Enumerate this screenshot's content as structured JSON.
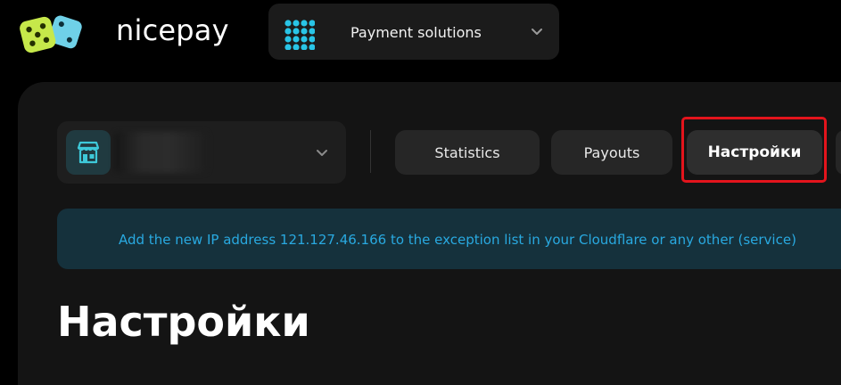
{
  "header": {
    "brand": "nicepay",
    "product_selector": {
      "label": "Payment solutions",
      "icon": "grid-icon"
    }
  },
  "shop_selector": {
    "icon": "store-icon",
    "name_redacted": true
  },
  "tabs": [
    {
      "label": "Statistics",
      "active": false
    },
    {
      "label": "Payouts",
      "active": false
    },
    {
      "label": "Настройки",
      "active": true,
      "highlighted": true
    }
  ],
  "notice": {
    "text": "Add the new IP address 121.127.46.166 to the exception list in your Cloudflare or any other (service)"
  },
  "page": {
    "title": "Настройки"
  },
  "colors": {
    "accent": "#29a9e0",
    "logo_green": "#c6e84a",
    "logo_blue": "#6fd1e8",
    "highlight_red": "#e3141c",
    "notice_bg": "#15313c"
  }
}
